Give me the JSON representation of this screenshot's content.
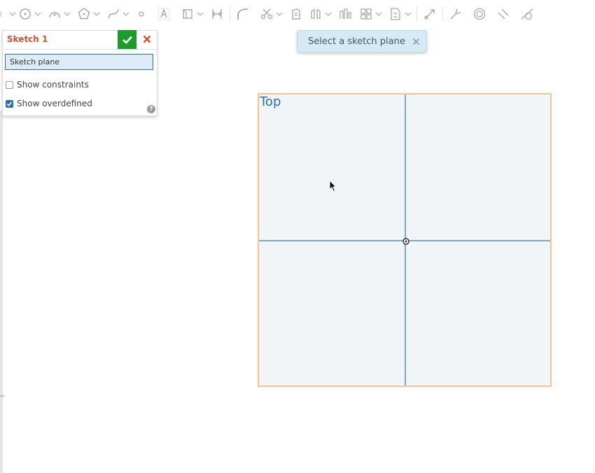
{
  "toolbar": {
    "icons": [
      "line-tool-icon",
      "circle-tool-icon",
      "arc-tool-icon",
      "polygon-tool-icon",
      "spline-tool-icon",
      "point-tool-icon",
      "text-tool-icon",
      "construction-tool-icon",
      "dimension-tool-icon",
      "fillet-tool-icon",
      "trim-tool-icon",
      "use-tool-icon",
      "mirror-tool-icon",
      "pattern-tool-icon",
      "dxf-import-icon",
      "transform-tool-icon",
      "intersection-tool-icon",
      "concentric-tool-icon",
      "parallel-tool-icon",
      "tangent-tool-icon"
    ]
  },
  "dialog": {
    "title": "Sketch 1",
    "field_value": "Sketch plane",
    "show_constraints_label": "Show constraints",
    "show_constraints_checked": false,
    "show_overdefined_label": "Show overdefined",
    "show_overdefined_checked": true,
    "help_glyph": "?"
  },
  "toast": {
    "message": "Select a sketch plane"
  },
  "plane": {
    "label": "Top"
  },
  "colors": {
    "accent": "#2b6fad",
    "confirm": "#1e9b2e",
    "cancel": "#d2502a",
    "plane_border": "#f4c48c",
    "axis": "#7fa3d2"
  }
}
